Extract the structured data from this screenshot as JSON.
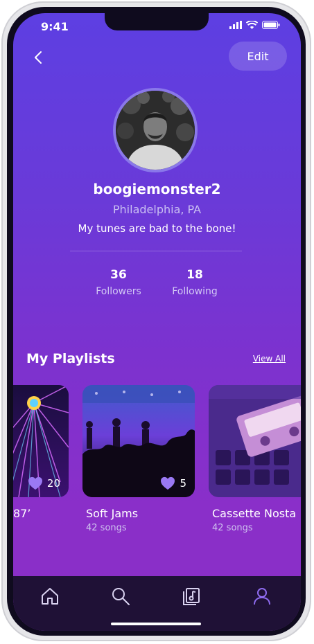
{
  "status_bar": {
    "time": "9:41"
  },
  "header": {
    "edit_label": "Edit"
  },
  "profile": {
    "username": "boogiemonster2",
    "location": "Philadelphia, PA",
    "bio": "My tunes are bad to the bone!",
    "followers_count": "36",
    "followers_label": "Followers",
    "following_count": "18",
    "following_label": "Following"
  },
  "playlists_section": {
    "title": "My Playlists",
    "view_all_label": "View All",
    "items": [
      {
        "title": "87’",
        "songs": "",
        "likes": "20"
      },
      {
        "title": "Soft Jams",
        "songs": "42 songs",
        "likes": "5"
      },
      {
        "title": "Cassette Nosta",
        "songs": "42 songs",
        "likes": ""
      }
    ]
  },
  "tab_bar": {
    "items": [
      {
        "icon": "home-icon",
        "active": false
      },
      {
        "icon": "search-icon",
        "active": false
      },
      {
        "icon": "library-icon",
        "active": false
      },
      {
        "icon": "profile-icon",
        "active": true
      }
    ]
  },
  "colors": {
    "gradient_top": "#5d3fe2",
    "gradient_bottom": "#8b2fc6",
    "tab_bar_bg": "#1f1136",
    "active_tab": "#8f6cf0"
  }
}
